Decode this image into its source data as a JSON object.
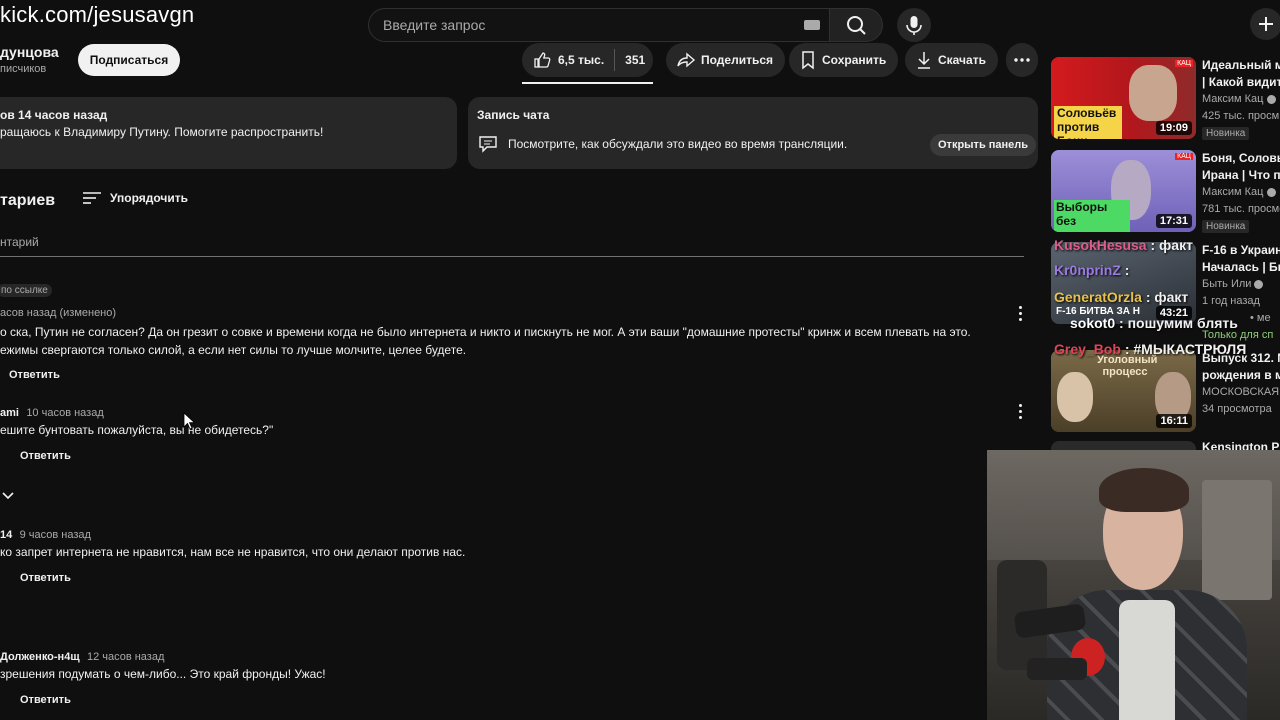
{
  "stream_overlay": {
    "url": "kick.com/jesusavgn",
    "chat": [
      {
        "user": "KusokHesusa",
        "user_color": "#e05a8a",
        "message": ": факт"
      },
      {
        "user": "Kr0nprinZ",
        "user_color": "#9b7be0",
        "message": ":"
      },
      {
        "user": "GeneratOrzla",
        "user_color": "#e8c24a",
        "message": ": факт"
      },
      {
        "user": "sokot0",
        "user_color": "#ffffff",
        "message": ": пошумим блять"
      },
      {
        "user": "Grey_Bob",
        "user_color": "#e0445a",
        "message": ": #МЫКАСТРЮЛЯ"
      }
    ]
  },
  "header": {
    "search_placeholder": "Введите запрос",
    "icons": [
      "keyboard-icon",
      "search-icon",
      "mic-icon",
      "plus-icon"
    ]
  },
  "channel": {
    "name": "дунцова",
    "subscribers": "писчиков",
    "subscribe_label": "Подписаться"
  },
  "actions": {
    "likes": "6,5 тыс.",
    "dislikes": "351",
    "share": "Поделиться",
    "save": "Сохранить",
    "download": "Скачать"
  },
  "description_card": {
    "meta": "ов  14 часов назад",
    "text": "ращаюсь к Владимиру Путину. Помогите распространить!"
  },
  "chat_card": {
    "title": "Запись чата",
    "text": "Посмотрите, как обсуждали это видео во время трансляции.",
    "button": "Открыть панель"
  },
  "comments_header": {
    "title": "тариев",
    "sort": "Упорядочить",
    "add_placeholder": "нтарий"
  },
  "comments": [
    {
      "badge": "по ссылке",
      "author": "",
      "time": "асов назад (изменено)",
      "lines": [
        "о ска, Путин не согласен? Да он грезит о совке и времени когда не было интернета и никто и пискнуть не мог. А эти ваши \"домашние протесты\" кринж и всем плевать на это.",
        "ежимы свергаются только силой, а если нет силы то лучше молчите, целее будете."
      ],
      "reply": "Ответить"
    },
    {
      "author": "ami",
      "time": "10 часов назад",
      "lines": [
        "ешите бунтовать пожалуйста, вы не обидетесь?\""
      ],
      "reply": "Ответить"
    },
    {
      "author": "14",
      "time": "9 часов назад",
      "lines": [
        "ко запрет интернета не нравится, нам все не нравится, что  они делают против нас."
      ],
      "reply": "Ответить"
    },
    {
      "author": "Долженко-н4щ",
      "time": "12 часов назад",
      "lines": [
        "зрешения подумать о чем-либо... Это край фронды! Ужас!"
      ],
      "reply": "Ответить"
    }
  ],
  "recommendations": [
    {
      "thumb_text": "Соловьёв против Бони",
      "duration": "19:09",
      "title1": "Идеальный м",
      "title2": "| Какой видит",
      "channel": "Максим Кац",
      "views": "425 тыс. просм",
      "badge": "Новинка",
      "thumb_color": "#c2151b",
      "corner": "КАЦ"
    },
    {
      "thumb_text": "Выборы без интернета",
      "duration": "17:31",
      "title1": "Боня, Соловь",
      "title2": "Ирана | Что пу",
      "channel": "Максим Кац",
      "views": "781 тыс. просмо",
      "badge": "Новинка",
      "thumb_color": "#7a6cc4",
      "corner": "КАЦ"
    },
    {
      "thumb_text": "F-16 БИТВА ЗА Н",
      "duration": "43:21",
      "title1": "F-16 в Украин",
      "title2": "Началась | Бы",
      "channel": "Быть Или",
      "views": "1 год назад",
      "extra": "• ме",
      "extra2": "Только для сп",
      "thumb_color": "#3b4048",
      "corner": ""
    },
    {
      "thumb_text": "Уголовный процесс",
      "duration": "16:11",
      "title1": "Выпуск 312. М",
      "title2": "рождения в м",
      "channel": "МОСКОВСКАЯ К",
      "views": "34 просмотра",
      "thumb_color": "#6b5a3a",
      "corner": ""
    },
    {
      "title1": "Kensington  Pl",
      "thumb_color": "#2a2a2a"
    }
  ]
}
